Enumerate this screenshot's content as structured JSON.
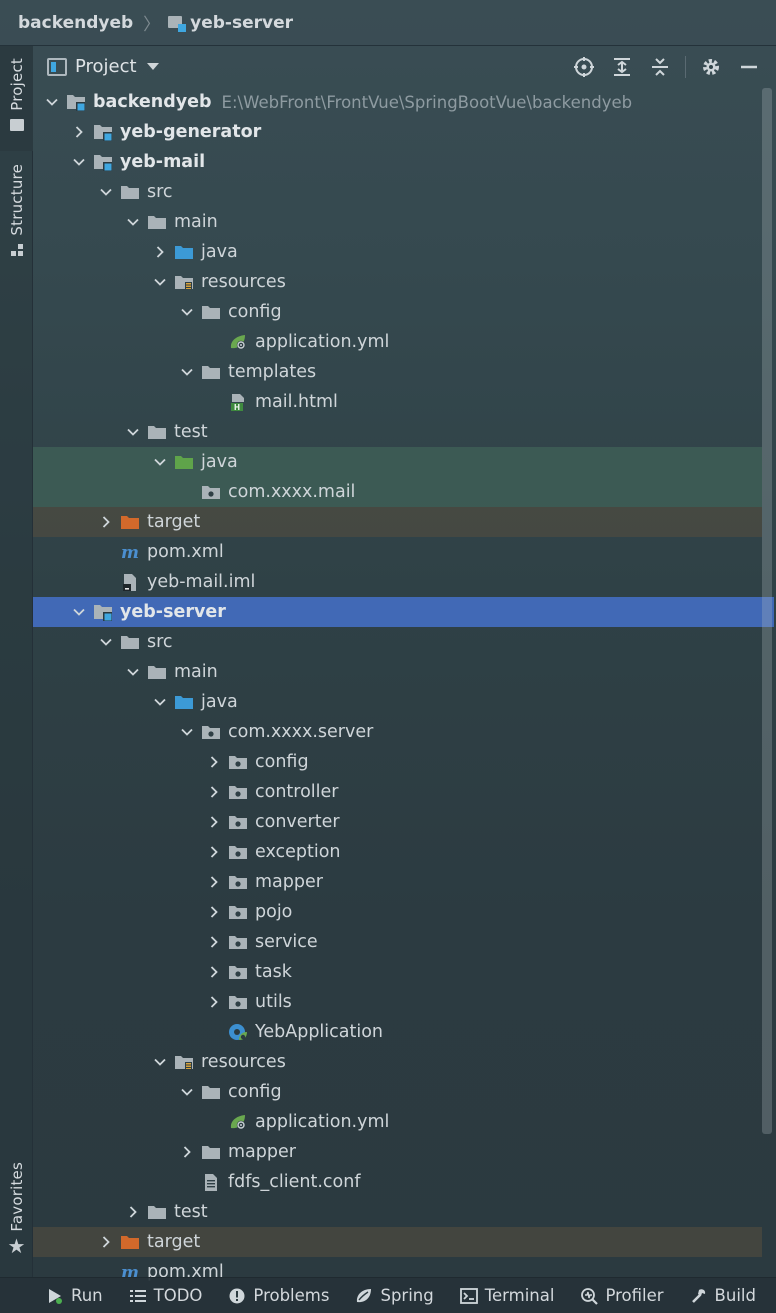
{
  "breadcrumb": {
    "root": "backendyeb",
    "current": "yeb-server"
  },
  "left_strip": {
    "project_tab": "Project",
    "structure_tab": "Structure",
    "favorites_tab": "Favorites"
  },
  "panel": {
    "title": "Project",
    "tools": [
      "locate-icon",
      "expand-all-icon",
      "collapse-all-icon",
      "gear-icon",
      "hide-icon"
    ]
  },
  "tree": [
    {
      "depth": 0,
      "chevron": "down",
      "icon": "module",
      "label": "backendyeb",
      "bold": true,
      "path": "E:\\WebFront\\FrontVue\\SpringBootVue\\backendyeb",
      "hl": ""
    },
    {
      "depth": 1,
      "chevron": "right",
      "icon": "module",
      "label": "yeb-generator",
      "bold": true,
      "hl": ""
    },
    {
      "depth": 1,
      "chevron": "down",
      "icon": "module",
      "label": "yeb-mail",
      "bold": true,
      "hl": ""
    },
    {
      "depth": 2,
      "chevron": "down",
      "icon": "folder",
      "label": "src",
      "hl": ""
    },
    {
      "depth": 3,
      "chevron": "down",
      "icon": "folder",
      "label": "main",
      "hl": ""
    },
    {
      "depth": 4,
      "chevron": "right",
      "icon": "folder-blue",
      "label": "java",
      "hl": ""
    },
    {
      "depth": 4,
      "chevron": "down",
      "icon": "folder-res",
      "label": "resources",
      "hl": ""
    },
    {
      "depth": 5,
      "chevron": "down",
      "icon": "folder",
      "label": "config",
      "hl": ""
    },
    {
      "depth": 6,
      "chevron": "none",
      "icon": "spring-yml",
      "label": "application.yml",
      "hl": ""
    },
    {
      "depth": 5,
      "chevron": "down",
      "icon": "folder",
      "label": "templates",
      "hl": ""
    },
    {
      "depth": 6,
      "chevron": "none",
      "icon": "html",
      "label": "mail.html",
      "hl": ""
    },
    {
      "depth": 3,
      "chevron": "down",
      "icon": "folder",
      "label": "test",
      "hl": ""
    },
    {
      "depth": 4,
      "chevron": "down",
      "icon": "folder-green",
      "label": "java",
      "hl": "green"
    },
    {
      "depth": 5,
      "chevron": "none",
      "icon": "package",
      "label": "com.xxxx.mail",
      "hl": "green"
    },
    {
      "depth": 2,
      "chevron": "right",
      "icon": "folder-orange",
      "label": "target",
      "hl": "orange"
    },
    {
      "depth": 2,
      "chevron": "none",
      "icon": "maven",
      "label": "pom.xml",
      "hl": ""
    },
    {
      "depth": 2,
      "chevron": "none",
      "icon": "iml",
      "label": "yeb-mail.iml",
      "hl": ""
    },
    {
      "depth": 1,
      "chevron": "down",
      "icon": "module",
      "label": "yeb-server",
      "bold": true,
      "hl": "selected"
    },
    {
      "depth": 2,
      "chevron": "down",
      "icon": "folder",
      "label": "src",
      "hl": ""
    },
    {
      "depth": 3,
      "chevron": "down",
      "icon": "folder",
      "label": "main",
      "hl": ""
    },
    {
      "depth": 4,
      "chevron": "down",
      "icon": "folder-blue",
      "label": "java",
      "hl": ""
    },
    {
      "depth": 5,
      "chevron": "down",
      "icon": "package",
      "label": "com.xxxx.server",
      "hl": ""
    },
    {
      "depth": 6,
      "chevron": "right",
      "icon": "package",
      "label": "config",
      "hl": ""
    },
    {
      "depth": 6,
      "chevron": "right",
      "icon": "package",
      "label": "controller",
      "hl": ""
    },
    {
      "depth": 6,
      "chevron": "right",
      "icon": "package",
      "label": "converter",
      "hl": ""
    },
    {
      "depth": 6,
      "chevron": "right",
      "icon": "package",
      "label": "exception",
      "hl": ""
    },
    {
      "depth": 6,
      "chevron": "right",
      "icon": "package",
      "label": "mapper",
      "hl": ""
    },
    {
      "depth": 6,
      "chevron": "right",
      "icon": "package",
      "label": "pojo",
      "hl": ""
    },
    {
      "depth": 6,
      "chevron": "right",
      "icon": "package",
      "label": "service",
      "hl": ""
    },
    {
      "depth": 6,
      "chevron": "right",
      "icon": "package",
      "label": "task",
      "hl": ""
    },
    {
      "depth": 6,
      "chevron": "right",
      "icon": "package",
      "label": "utils",
      "hl": ""
    },
    {
      "depth": 6,
      "chevron": "none",
      "icon": "spring-class",
      "label": "YebApplication",
      "hl": ""
    },
    {
      "depth": 4,
      "chevron": "down",
      "icon": "folder-res",
      "label": "resources",
      "hl": ""
    },
    {
      "depth": 5,
      "chevron": "down",
      "icon": "folder",
      "label": "config",
      "hl": ""
    },
    {
      "depth": 6,
      "chevron": "none",
      "icon": "spring-yml",
      "label": "application.yml",
      "hl": ""
    },
    {
      "depth": 5,
      "chevron": "right",
      "icon": "folder",
      "label": "mapper",
      "hl": ""
    },
    {
      "depth": 5,
      "chevron": "none",
      "icon": "text-file",
      "label": "fdfs_client.conf",
      "hl": ""
    },
    {
      "depth": 3,
      "chevron": "right",
      "icon": "folder",
      "label": "test",
      "hl": ""
    },
    {
      "depth": 2,
      "chevron": "right",
      "icon": "folder-orange",
      "label": "target",
      "hl": "orange"
    },
    {
      "depth": 2,
      "chevron": "none",
      "icon": "maven",
      "label": "pom.xml",
      "hl": ""
    }
  ],
  "bottom_bar": [
    {
      "icon": "run-icon",
      "label": "Run"
    },
    {
      "icon": "todo-icon",
      "label": "TODO"
    },
    {
      "icon": "problems-icon",
      "label": "Problems"
    },
    {
      "icon": "spring-icon",
      "label": "Spring"
    },
    {
      "icon": "terminal-icon",
      "label": "Terminal"
    },
    {
      "icon": "profiler-icon",
      "label": "Profiler"
    },
    {
      "icon": "build-icon",
      "label": "Build"
    }
  ],
  "colors": {
    "selection": "#4169b6",
    "folder": "#aab3b8",
    "source_folder": "#3c9ad6",
    "test_folder": "#5fa44a",
    "excluded_folder": "#d2692b"
  }
}
